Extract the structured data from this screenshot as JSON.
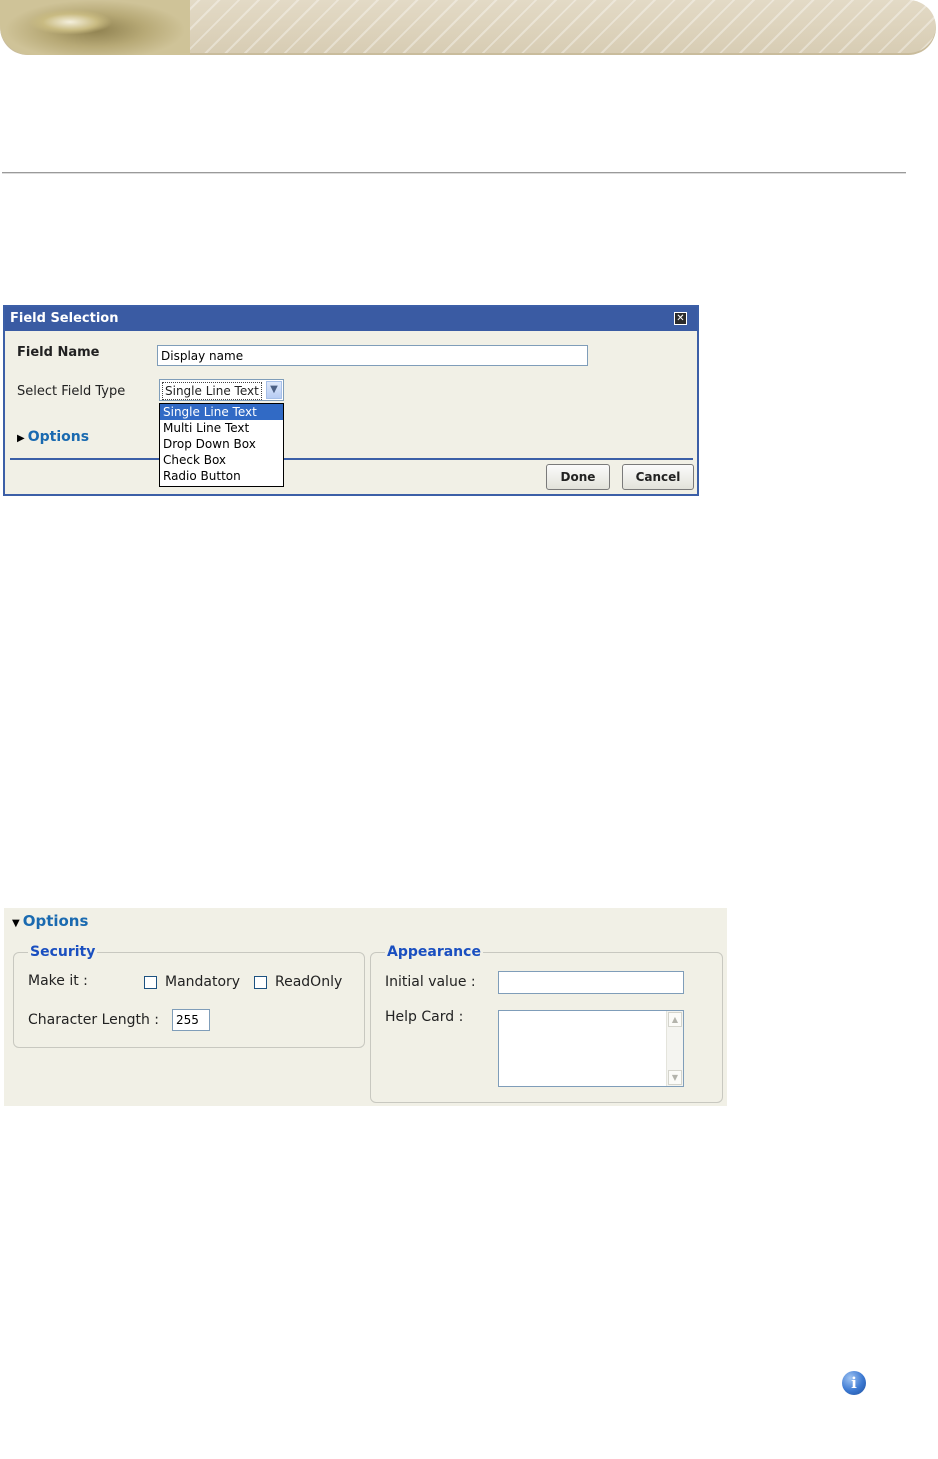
{
  "dialog": {
    "title": "Field Selection",
    "field_name_label": "Field Name",
    "field_name_value": "Display name",
    "field_type_label": "Select Field Type",
    "field_type_selected": "Single Line Text",
    "field_type_options": [
      "Single Line Text",
      "Multi Line Text",
      "Drop Down Box",
      "Check Box",
      "Radio Button"
    ],
    "options_label": "Options",
    "done_label": "Done",
    "cancel_label": "Cancel"
  },
  "options_panel": {
    "title": "Options",
    "security": {
      "legend": "Security",
      "make_it_label": "Make it :",
      "mandatory_label": "Mandatory",
      "readonly_label": "ReadOnly",
      "char_length_label": "Character Length :",
      "char_length_value": "255"
    },
    "appearance": {
      "legend": "Appearance",
      "initial_value_label": "Initial value :",
      "initial_value": "",
      "help_card_label": "Help Card :"
    }
  },
  "colors": {
    "dialog_title_bg": "#3a5ba3",
    "panel_bg": "#f1f0e6",
    "link_blue": "#1a6ab0",
    "legend_blue": "#1a4fc0"
  }
}
